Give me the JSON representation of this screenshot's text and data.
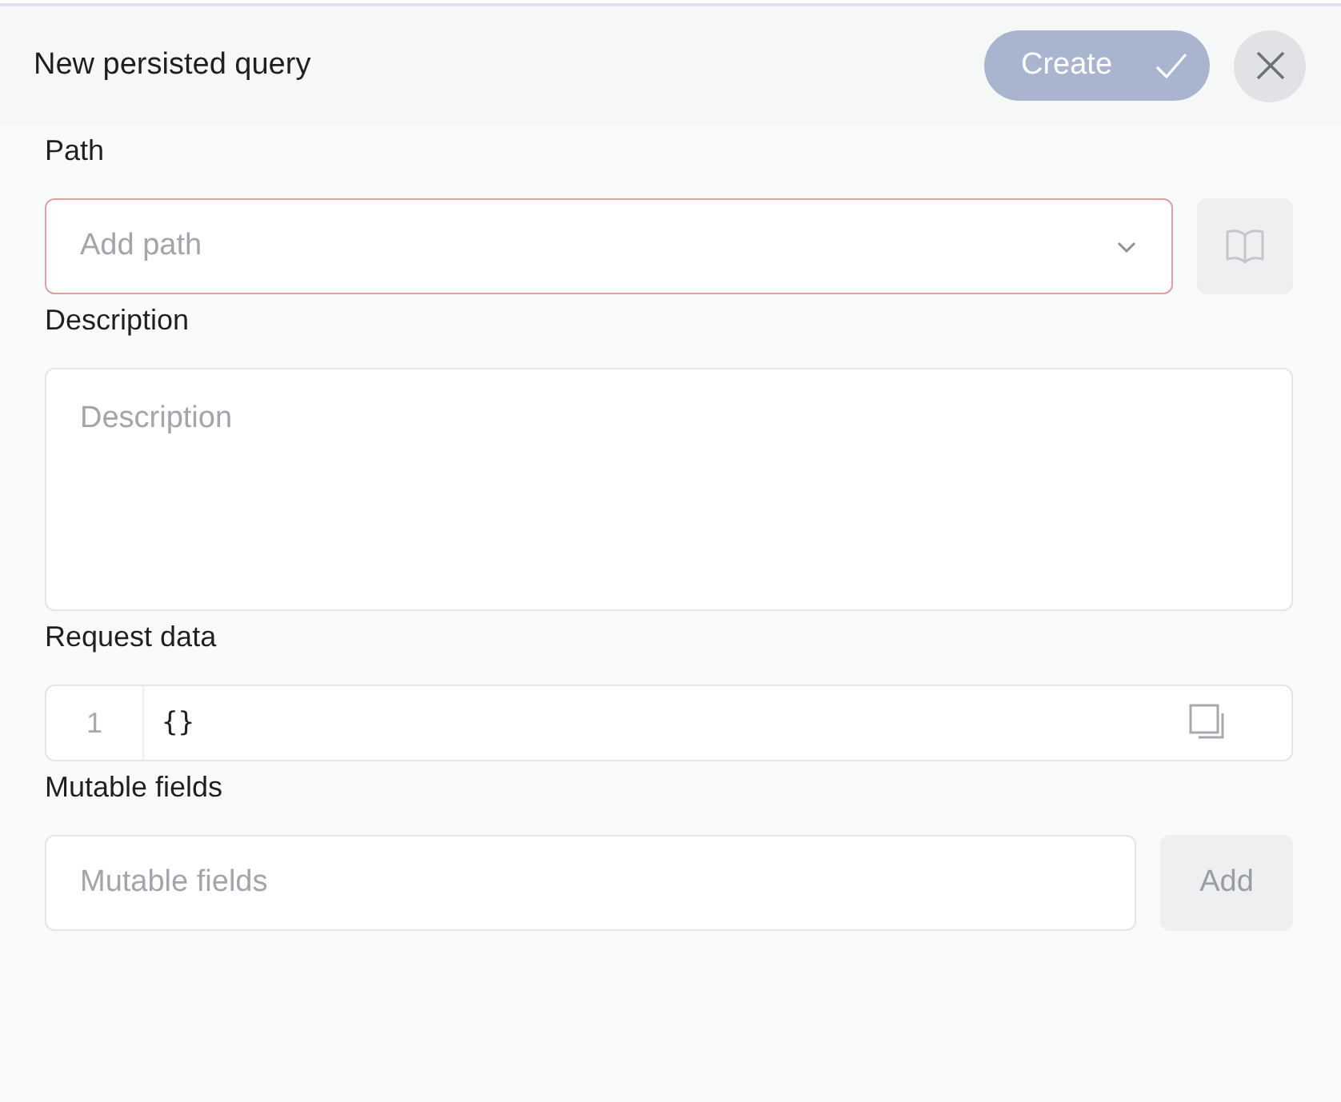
{
  "header": {
    "title": "New persisted query",
    "create_button": {
      "label": "Create",
      "disabled": true
    }
  },
  "form": [
    {
      "kind": "select",
      "label": "Path",
      "placeholder": "Add path",
      "invalid": true
    },
    {
      "kind": "textarea",
      "label": "Description",
      "placeholder": "Description"
    },
    {
      "kind": "code",
      "label": "Request data",
      "lines": [
        {
          "number": "1",
          "text": "{}"
        }
      ]
    },
    {
      "kind": "input_add",
      "label": "Mutable fields",
      "placeholder": "Mutable fields",
      "button": {
        "label": "Add",
        "disabled": true
      }
    }
  ]
}
